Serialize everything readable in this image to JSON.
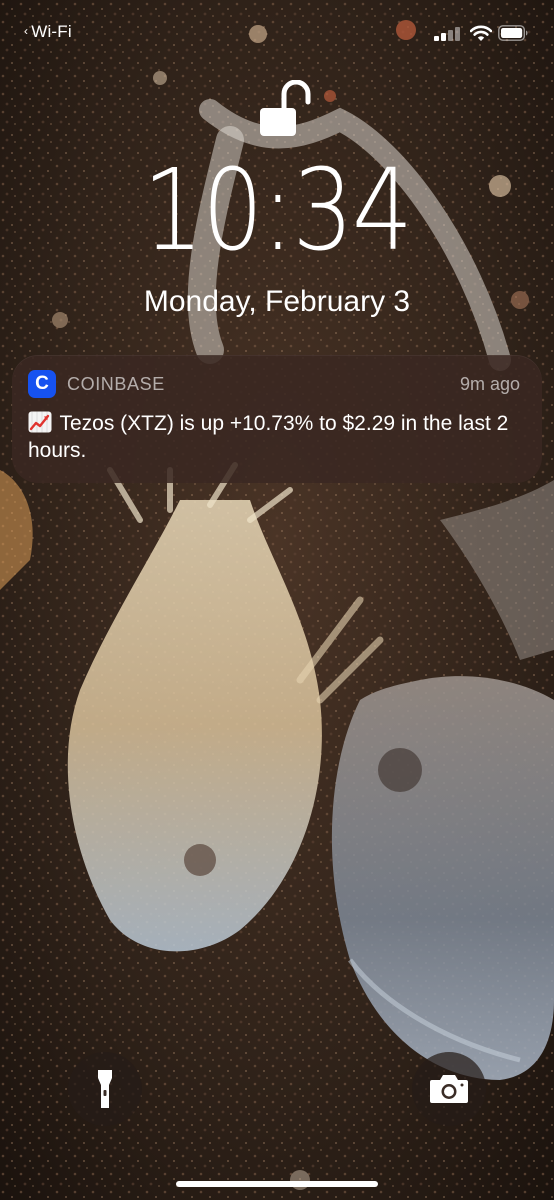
{
  "status_bar": {
    "carrier": "Wi-Fi",
    "carrier_icon": "chevron-left-icon",
    "signal_icon": "cellular-signal-icon",
    "wifi_icon": "wifi-icon",
    "battery_icon": "battery-icon"
  },
  "lock_screen": {
    "lock_icon": "unlocked-padlock-icon",
    "time": "10:34",
    "date": "Monday, February 3"
  },
  "notification": {
    "app_icon_letter": "C",
    "app_icon_color": "#1652f0",
    "app_name": "COINBASE",
    "time_ago": "9m ago",
    "emoji_icon": "chart-increasing-icon",
    "message": "Tezos (XTZ) is up +10.73% to $2.29 in the last 2 hours."
  },
  "quick_actions": {
    "flashlight_icon": "flashlight-icon",
    "camera_icon": "camera-icon"
  }
}
